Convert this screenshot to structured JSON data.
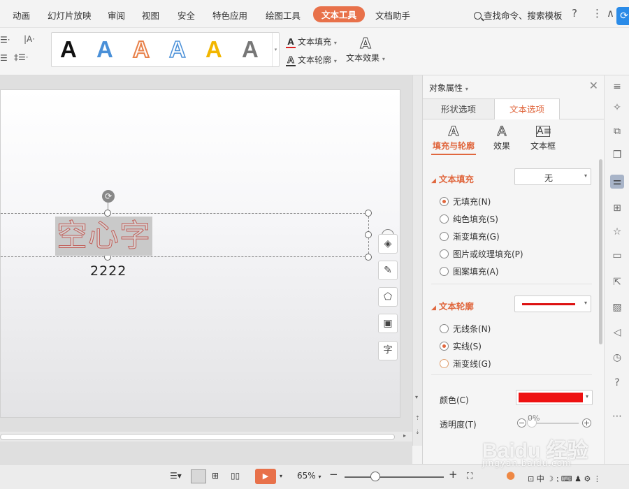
{
  "menubar": {
    "items": [
      "动画",
      "幻灯片放映",
      "审阅",
      "视图",
      "安全",
      "特色应用",
      "绘图工具",
      "文本工具",
      "文档助手"
    ],
    "active": "文本工具",
    "search_label": "查找命令、搜索模板",
    "help_icon": "?",
    "more_icon": "⋮",
    "collapse_icon": "∧"
  },
  "ribbon": {
    "style_gallery": [
      "A",
      "A",
      "A",
      "A",
      "A",
      "A"
    ],
    "style_colors": [
      "#111111",
      "#4a90d8",
      "#e8814a",
      "#4a90d8",
      "#f2b600",
      "#777777"
    ],
    "text_fill": "文本填充",
    "text_outline": "文本轮廓",
    "text_effect": "文本效果"
  },
  "slide": {
    "hollow_text": "空心字",
    "sub_text": "2222"
  },
  "panel": {
    "title": "对象属性",
    "tabs": [
      "形状选项",
      "文本选项"
    ],
    "active_tab": "文本选项",
    "subtabs": [
      "填充与轮廓",
      "效果",
      "文本框"
    ],
    "active_subtab": "填充与轮廓",
    "fill_section": "文本填充",
    "fill_value": "无",
    "fill_options": [
      "无填充(N)",
      "纯色填充(S)",
      "渐变填充(G)",
      "图片或纹理填充(P)",
      "图案填充(A)"
    ],
    "fill_checked": 0,
    "outline_section": "文本轮廓",
    "outline_color": "#dd1111",
    "outline_options": [
      "无线条(N)",
      "实线(S)",
      "渐变线(G)"
    ],
    "outline_checked": 1,
    "color_label": "颜色(C)",
    "color_value": "#ee1111",
    "transparency_label": "透明度(T)",
    "transparency_value": "0%"
  },
  "statusbar": {
    "zoom": "65%",
    "ime_label": "中"
  },
  "watermark": {
    "main": "Baidu 经验",
    "sub": "jingyan.baidu.com"
  }
}
